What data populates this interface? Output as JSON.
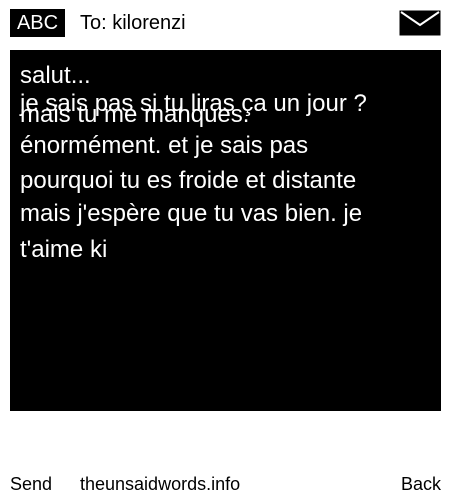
{
  "header": {
    "input_mode": "ABC",
    "recipient_line": "To: kilorenzi",
    "message_icon": "envelope-icon"
  },
  "message": {
    "lines": [
      "salut...",
      "je sais pas si tu liras ça un jour ?",
      "mais tu me manques.",
      "énormément. et je sais pas",
      "pourquoi tu es froide et distante",
      "mais j'espère que tu vas bien. je",
      "t'aime ki"
    ]
  },
  "softkeys": {
    "left": "Send",
    "middle": "theunsaidwords.info",
    "right": "Back"
  },
  "colors": {
    "message_background": "#000000",
    "message_text": "#ffffff",
    "page_background": "#ffffff"
  }
}
